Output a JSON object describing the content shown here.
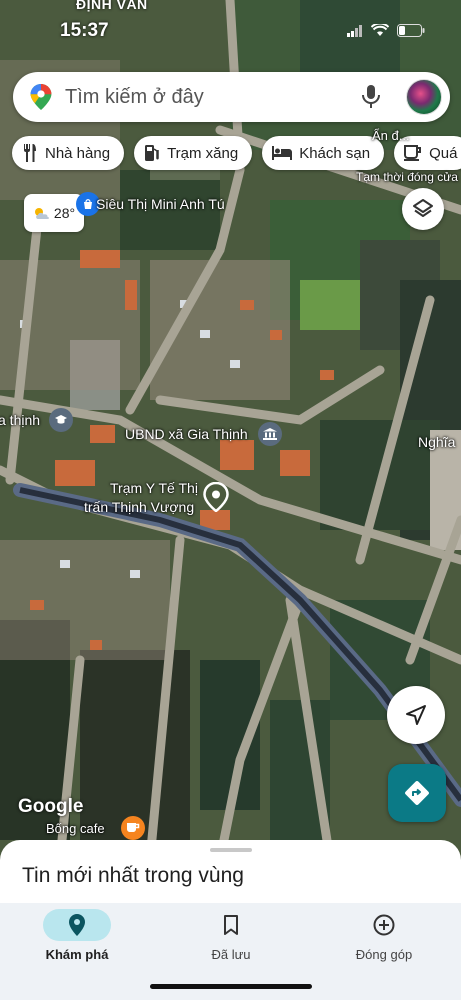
{
  "status_bar": {
    "location": "ĐỊNH VĂN",
    "time": "15:37"
  },
  "search": {
    "placeholder": "Tìm kiếm ở đây"
  },
  "chips": [
    {
      "label": "Nhà hàng",
      "icon": "restaurant-icon"
    },
    {
      "label": "Trạm xăng",
      "icon": "gas-station-icon"
    },
    {
      "label": "Khách sạn",
      "icon": "hotel-icon"
    },
    {
      "label": "Quá",
      "icon": "cafe-icon"
    }
  ],
  "weather": {
    "temp": "28°",
    "icon": "partly-cloudy-icon"
  },
  "map_labels": {
    "closed_notice": "Tạm thời đóng cửa",
    "store": "Siêu Thị Mini Anh Tú",
    "village_left": "a thịnh",
    "town_hall": "UBND xã Gia Thịnh",
    "village_right": "Nghĩa",
    "clinic_line1": "Trạm Y Tế Thị",
    "clinic_line2": "trấn Thịnh Vượng",
    "cafe": "Bống cafe",
    "partial_top": "Ẩn đ..."
  },
  "google_logo": "Google",
  "sheet": {
    "title": "Tin mới nhất trong vùng"
  },
  "bottom_nav": [
    {
      "label": "Khám phá",
      "icon": "explore-pin-icon",
      "active": true
    },
    {
      "label": "Đã lưu",
      "icon": "bookmark-icon",
      "active": false
    },
    {
      "label": "Đóng góp",
      "icon": "add-circle-icon",
      "active": false
    }
  ],
  "colors": {
    "accent": "#0b7a86",
    "active_pill": "#b9e6ee",
    "nav_bg": "#eef2f6"
  }
}
